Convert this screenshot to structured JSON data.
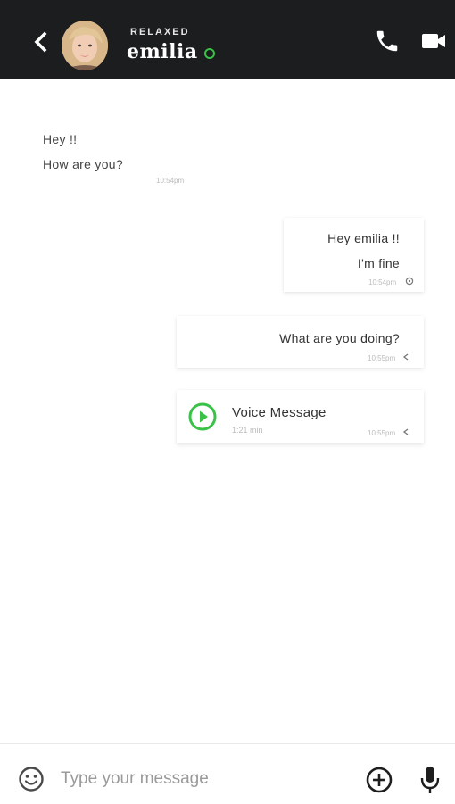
{
  "header": {
    "status": "RELAXED",
    "contact_name": "emilia",
    "online_color": "#39c247",
    "icons": [
      "chevron-left-icon",
      "phone-icon",
      "video-camera-icon"
    ]
  },
  "messages": [
    {
      "direction": "incoming",
      "lines": [
        "Hey !!",
        "How are you?"
      ],
      "time": "10:54pm"
    },
    {
      "direction": "outgoing",
      "lines": [
        "Hey emilia !!",
        "I'm fine"
      ],
      "time": "10:54pm",
      "status_icon": "seen-icon"
    },
    {
      "direction": "outgoing",
      "lines": [
        "What are you doing?"
      ],
      "time": "10:55pm",
      "status_icon": "sent-icon"
    },
    {
      "direction": "outgoing",
      "type": "voice",
      "title": "Voice Message",
      "duration": "1:21 min",
      "time": "10:55pm",
      "status_icon": "sent-icon"
    }
  ],
  "composer": {
    "placeholder": "Type your message",
    "icons": [
      "emoji-icon",
      "add-circle-icon",
      "microphone-icon"
    ]
  },
  "colors": {
    "header_bg": "#1b1d1e",
    "accent_green": "#39c247"
  }
}
